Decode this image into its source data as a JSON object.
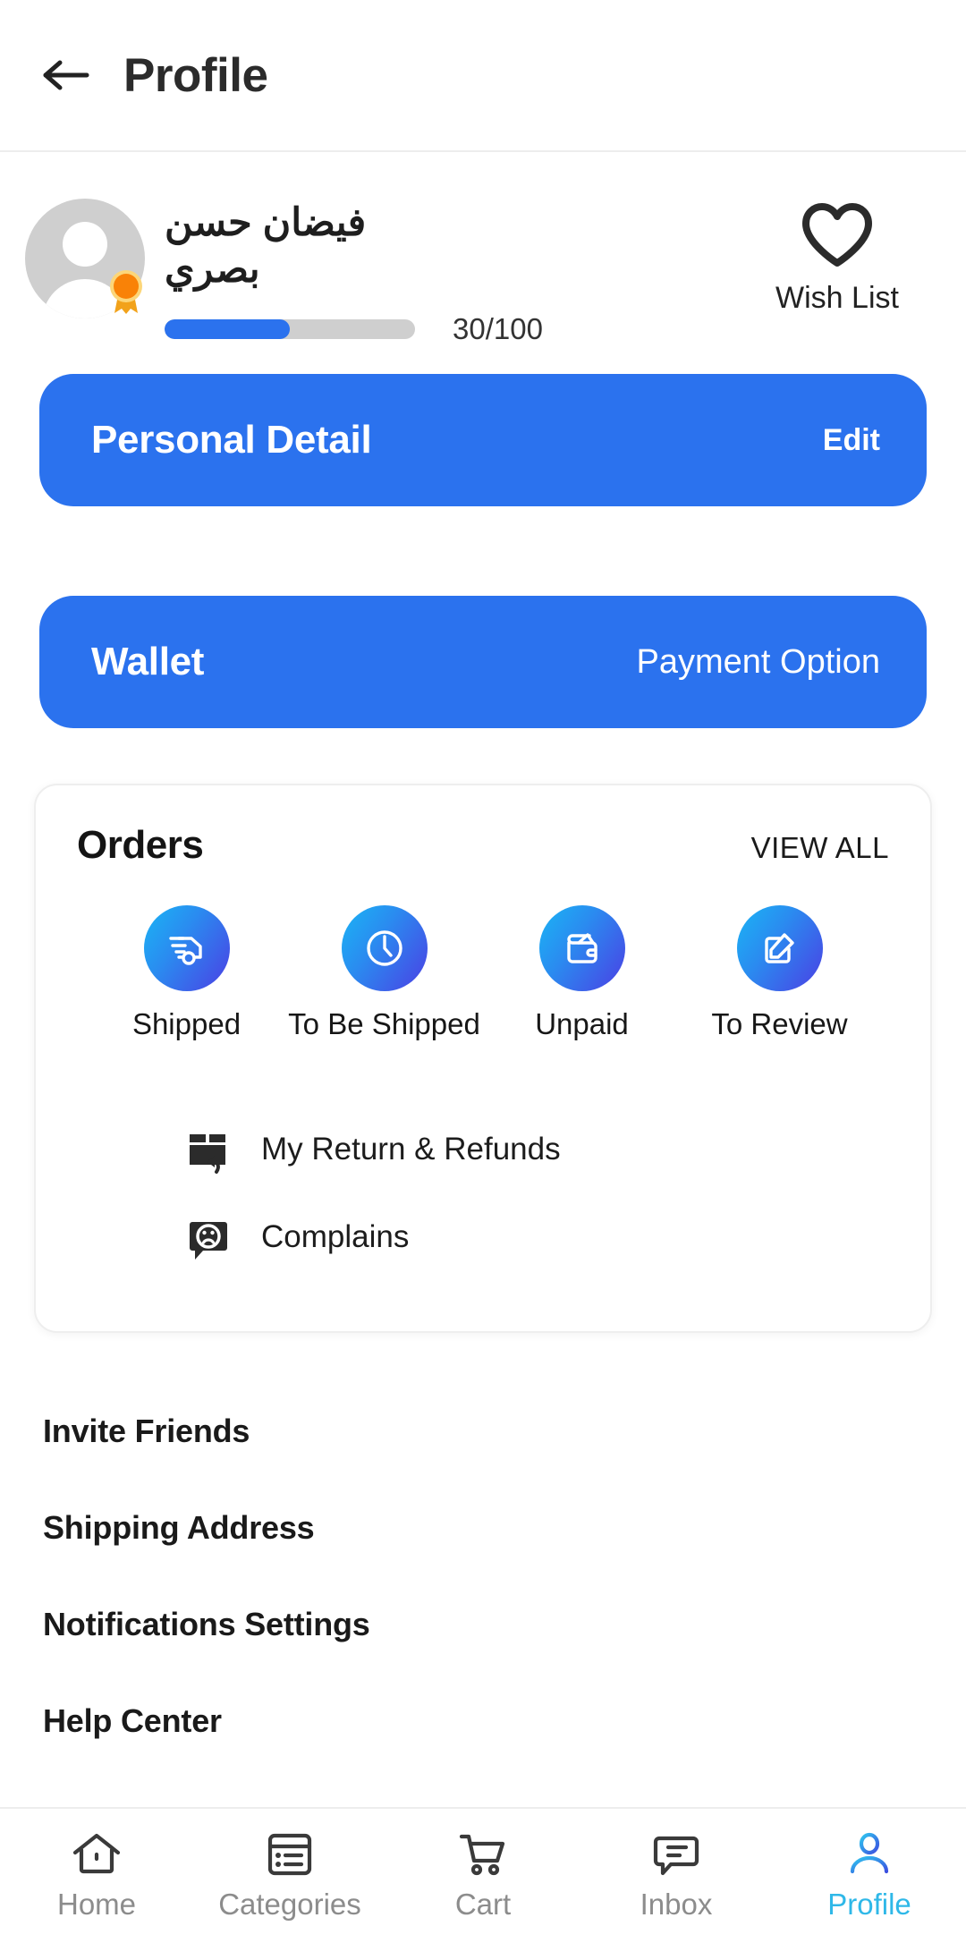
{
  "header": {
    "back_icon": "arrow-left-icon",
    "title": "Profile"
  },
  "profile": {
    "avatar_icon": "user-avatar-placeholder",
    "badge_icon": "award-badge-icon",
    "name": "فيضان حسن بصري",
    "progress": {
      "value": 30,
      "max": 100,
      "label": "30/100",
      "fill_percent": 50,
      "fill_color": "#2b72ee",
      "track_color": "#cfcfcf"
    },
    "wishlist": {
      "icon": "heart-icon",
      "label": "Wish List"
    }
  },
  "cards": {
    "personal_detail": {
      "title": "Personal Detail",
      "action": "Edit",
      "color": "#2b72ee"
    },
    "wallet": {
      "title": "Wallet",
      "action": "Payment Option",
      "color": "#2b72ee"
    }
  },
  "orders": {
    "title": "Orders",
    "view_all": "VIEW ALL",
    "statuses": [
      {
        "label": "Shipped",
        "icon": "delivery-truck-icon"
      },
      {
        "label": "To Be Shipped",
        "icon": "clock-icon"
      },
      {
        "label": "Unpaid",
        "icon": "wallet-icon"
      },
      {
        "label": "To Review",
        "icon": "edit-square-icon"
      }
    ],
    "links": [
      {
        "label": "My Return & Refunds",
        "icon": "box-return-icon"
      },
      {
        "label": "Complains",
        "icon": "sad-face-chat-icon"
      }
    ],
    "gradient_from": "#1ab5f5",
    "gradient_to": "#4b3fe4"
  },
  "menu": [
    {
      "label": "Invite Friends"
    },
    {
      "label": "Shipping Address"
    },
    {
      "label": "Notifications Settings"
    },
    {
      "label": "Help Center"
    }
  ],
  "bottom_nav": {
    "active_color": "#2fb8e8",
    "inactive_color": "#8c8c8c",
    "items": [
      {
        "label": "Home",
        "icon": "home-icon",
        "active": false
      },
      {
        "label": "Categories",
        "icon": "categories-list-icon",
        "active": false
      },
      {
        "label": "Cart",
        "icon": "shopping-cart-icon",
        "active": false
      },
      {
        "label": "Inbox",
        "icon": "chat-bubble-icon",
        "active": false
      },
      {
        "label": "Profile",
        "icon": "user-icon",
        "active": true
      }
    ]
  }
}
